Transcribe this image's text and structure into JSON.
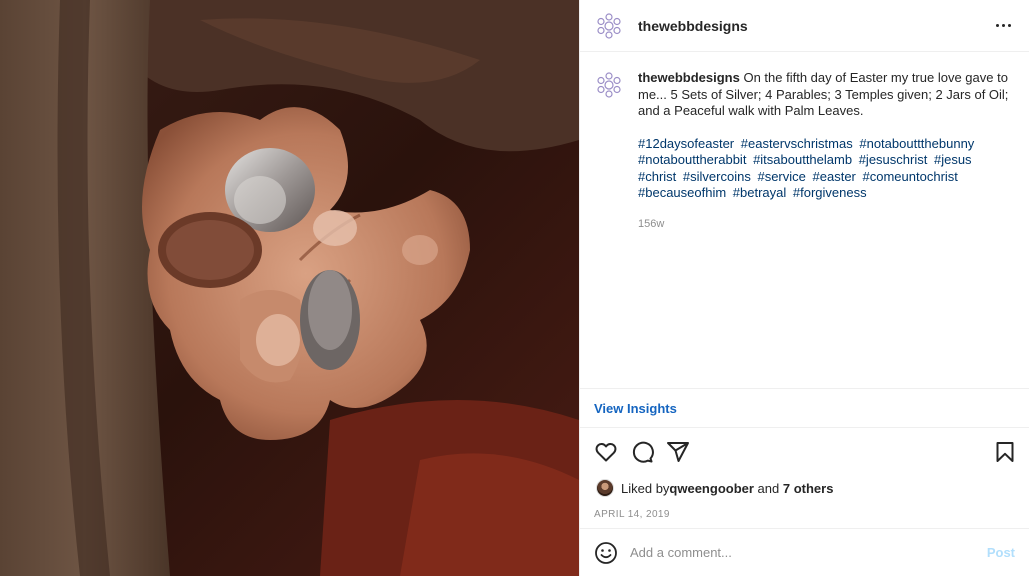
{
  "post": {
    "username": "thewebbdesigns",
    "caption_text": " On the fifth day of Easter my true love gave to me... 5 Sets of Silver; 4 Parables; 3 Temples given; 2 Jars of Oil; and a Peaceful walk with Palm Leaves.",
    "hashtags": [
      "#12daysofeaster",
      "#eastervschristmas",
      "#notabouttthebunny",
      "#notabouttherabbit",
      "#itsaboutthelamb",
      "#jesuschrist",
      "#jesus",
      "#christ",
      "#silvercoins",
      "#service",
      "#easter",
      "#comeuntochrist",
      "#becauseofhim",
      "#betrayal",
      "#forgiveness"
    ],
    "age": "156w",
    "date": "APRIL 14, 2019"
  },
  "insights": {
    "label": "View Insights"
  },
  "likes": {
    "prefix": "Liked by ",
    "liker": "qweengoober",
    "middle": " and ",
    "others": "7 others"
  },
  "comment": {
    "placeholder": "Add a comment...",
    "post_label": "Post"
  },
  "icons": {
    "header_more": "more-horizontal-icon",
    "like": "heart-icon",
    "comment": "comment-bubble-icon",
    "share": "paper-plane-icon",
    "save": "bookmark-icon",
    "emoji": "smiley-icon"
  },
  "colors": {
    "link_blue": "#00376b",
    "insights_blue": "#1565c0",
    "post_disabled": "#b2dffc",
    "muted": "#8e8e8e"
  }
}
